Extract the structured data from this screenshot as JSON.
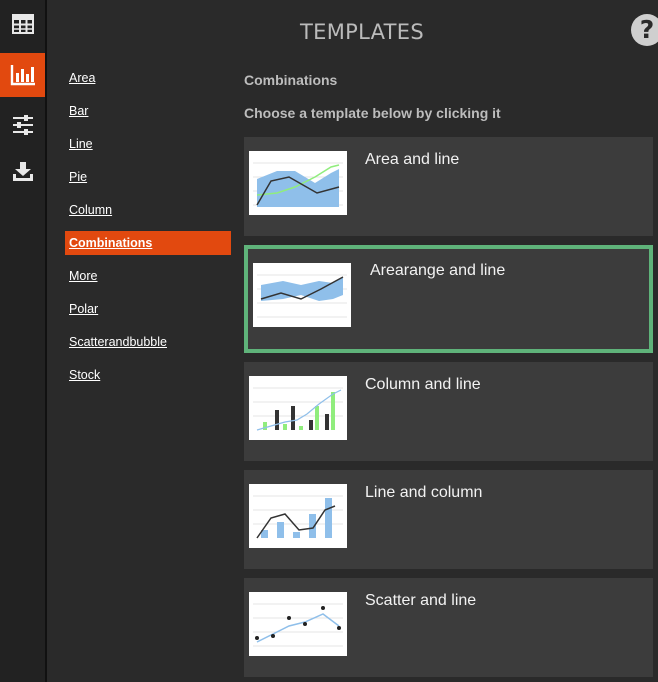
{
  "rail": {
    "items": [
      {
        "icon": "table-icon",
        "active": false
      },
      {
        "icon": "bar-chart-icon",
        "active": true
      },
      {
        "icon": "sliders-icon",
        "active": false
      },
      {
        "icon": "download-icon",
        "active": false
      }
    ]
  },
  "header": {
    "title": "TEMPLATES",
    "help_label": "?"
  },
  "categories": [
    {
      "label": "Area"
    },
    {
      "label": "Bar"
    },
    {
      "label": "Line"
    },
    {
      "label": "Pie"
    },
    {
      "label": "Column"
    },
    {
      "label": "Combinations",
      "active": true
    },
    {
      "label": "More"
    },
    {
      "label": "Polar"
    },
    {
      "label": "Scatterandbubble"
    },
    {
      "label": "Stock"
    }
  ],
  "main": {
    "group_title": "Combinations",
    "hint": "Choose a template below by clicking it",
    "templates": [
      {
        "label": "Area and line",
        "thumb": "area-line-thumbnail"
      },
      {
        "label": "Arearange and line",
        "thumb": "arearange-line-thumbnail",
        "selected": true
      },
      {
        "label": "Column and line",
        "thumb": "column-line-thumbnail"
      },
      {
        "label": "Line and column",
        "thumb": "line-column-thumbnail"
      },
      {
        "label": "Scatter and line",
        "thumb": "scatter-line-thumbnail"
      }
    ]
  },
  "colors": {
    "accent": "#e2490f",
    "selected_border": "#5fb37a",
    "card_bg": "#3c3c3c",
    "thumb_blue": "#8fbfea",
    "thumb_green": "#90ed7d",
    "thumb_dark": "#333333"
  }
}
